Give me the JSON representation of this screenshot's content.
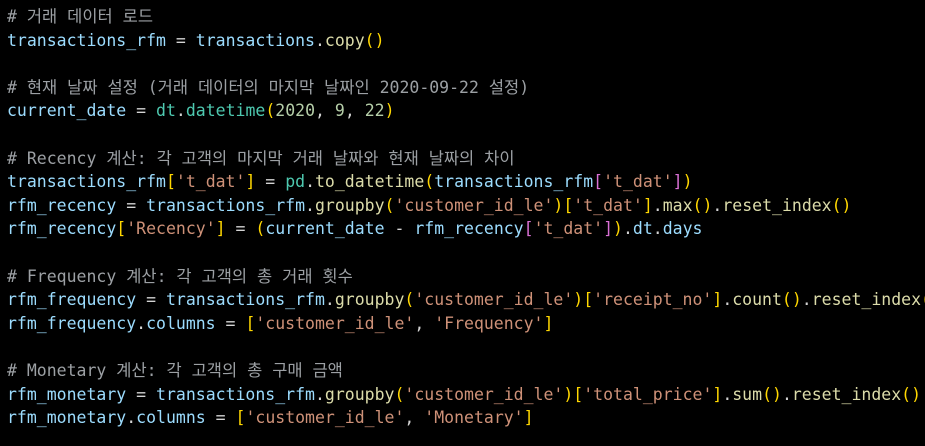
{
  "code": {
    "lines": [
      [
        [
          "c",
          "# 거래 데이터 로드"
        ]
      ],
      [
        [
          "v",
          "transactions_rfm"
        ],
        [
          "o",
          " = "
        ],
        [
          "v",
          "transactions"
        ],
        [
          "p",
          "."
        ],
        [
          "f",
          "copy"
        ],
        [
          "b1",
          "()"
        ]
      ],
      [],
      [
        [
          "c",
          "# 현재 날짜 설정 (거래 데이터의 마지막 날짜인 2020-09-22 설정)"
        ]
      ],
      [
        [
          "v",
          "current_date"
        ],
        [
          "o",
          " = "
        ],
        [
          "ty",
          "dt"
        ],
        [
          "p",
          "."
        ],
        [
          "ty",
          "datetime"
        ],
        [
          "b1",
          "("
        ],
        [
          "n",
          "2020"
        ],
        [
          "p",
          ", "
        ],
        [
          "n",
          "9"
        ],
        [
          "p",
          ", "
        ],
        [
          "n",
          "22"
        ],
        [
          "b1",
          ")"
        ]
      ],
      [],
      [
        [
          "c",
          "# Recency 계산: 각 고객의 마지막 거래 날짜와 현재 날짜의 차이"
        ]
      ],
      [
        [
          "v",
          "transactions_rfm"
        ],
        [
          "b1",
          "["
        ],
        [
          "s",
          "'t_dat'"
        ],
        [
          "b1",
          "]"
        ],
        [
          "o",
          " = "
        ],
        [
          "ty",
          "pd"
        ],
        [
          "p",
          "."
        ],
        [
          "f",
          "to_datetime"
        ],
        [
          "b1",
          "("
        ],
        [
          "v",
          "transactions_rfm"
        ],
        [
          "b2",
          "["
        ],
        [
          "s",
          "'t_dat'"
        ],
        [
          "b2",
          "]"
        ],
        [
          "b1",
          ")"
        ]
      ],
      [
        [
          "v",
          "rfm_recency"
        ],
        [
          "o",
          " = "
        ],
        [
          "v",
          "transactions_rfm"
        ],
        [
          "p",
          "."
        ],
        [
          "f",
          "groupby"
        ],
        [
          "b1",
          "("
        ],
        [
          "s",
          "'customer_id_le'"
        ],
        [
          "b1",
          ")"
        ],
        [
          "b1",
          "["
        ],
        [
          "s",
          "'t_dat'"
        ],
        [
          "b1",
          "]"
        ],
        [
          "p",
          "."
        ],
        [
          "f",
          "max"
        ],
        [
          "b1",
          "()"
        ],
        [
          "p",
          "."
        ],
        [
          "f",
          "reset_index"
        ],
        [
          "b1",
          "()"
        ]
      ],
      [
        [
          "v",
          "rfm_recency"
        ],
        [
          "b1",
          "["
        ],
        [
          "s",
          "'Recency'"
        ],
        [
          "b1",
          "]"
        ],
        [
          "o",
          " = "
        ],
        [
          "b1",
          "("
        ],
        [
          "v",
          "current_date"
        ],
        [
          "o",
          " - "
        ],
        [
          "v",
          "rfm_recency"
        ],
        [
          "b2",
          "["
        ],
        [
          "s",
          "'t_dat'"
        ],
        [
          "b2",
          "]"
        ],
        [
          "b1",
          ")"
        ],
        [
          "p",
          "."
        ],
        [
          "v",
          "dt"
        ],
        [
          "p",
          "."
        ],
        [
          "v",
          "days"
        ]
      ],
      [],
      [
        [
          "c",
          "# Frequency 계산: 각 고객의 총 거래 횟수"
        ]
      ],
      [
        [
          "v",
          "rfm_frequency"
        ],
        [
          "o",
          " = "
        ],
        [
          "v",
          "transactions_rfm"
        ],
        [
          "p",
          "."
        ],
        [
          "f",
          "groupby"
        ],
        [
          "b1",
          "("
        ],
        [
          "s",
          "'customer_id_le'"
        ],
        [
          "b1",
          ")"
        ],
        [
          "b1",
          "["
        ],
        [
          "s",
          "'receipt_no'"
        ],
        [
          "b1",
          "]"
        ],
        [
          "p",
          "."
        ],
        [
          "f",
          "count"
        ],
        [
          "b1",
          "()"
        ],
        [
          "p",
          "."
        ],
        [
          "f",
          "reset_index"
        ],
        [
          "b1",
          "()"
        ]
      ],
      [
        [
          "v",
          "rfm_frequency"
        ],
        [
          "p",
          "."
        ],
        [
          "v",
          "columns"
        ],
        [
          "o",
          " = "
        ],
        [
          "b1",
          "["
        ],
        [
          "s",
          "'customer_id_le'"
        ],
        [
          "p",
          ", "
        ],
        [
          "s",
          "'Frequency'"
        ],
        [
          "b1",
          "]"
        ]
      ],
      [],
      [
        [
          "c",
          "# Monetary 계산: 각 고객의 총 구매 금액"
        ]
      ],
      [
        [
          "v",
          "rfm_monetary"
        ],
        [
          "o",
          " = "
        ],
        [
          "v",
          "transactions_rfm"
        ],
        [
          "p",
          "."
        ],
        [
          "f",
          "groupby"
        ],
        [
          "b1",
          "("
        ],
        [
          "s",
          "'customer_id_le'"
        ],
        [
          "b1",
          ")"
        ],
        [
          "b1",
          "["
        ],
        [
          "s",
          "'total_price'"
        ],
        [
          "b1",
          "]"
        ],
        [
          "p",
          "."
        ],
        [
          "f",
          "sum"
        ],
        [
          "b1",
          "()"
        ],
        [
          "p",
          "."
        ],
        [
          "f",
          "reset_index"
        ],
        [
          "b1",
          "()"
        ]
      ],
      [
        [
          "v",
          "rfm_monetary"
        ],
        [
          "p",
          "."
        ],
        [
          "v",
          "columns"
        ],
        [
          "o",
          " = "
        ],
        [
          "b1",
          "["
        ],
        [
          "s",
          "'customer_id_le'"
        ],
        [
          "p",
          ", "
        ],
        [
          "s",
          "'Monetary'"
        ],
        [
          "b1",
          "]"
        ]
      ]
    ]
  },
  "theme": {
    "background": "#000000",
    "comment": "#9ca0a4",
    "variable": "#9cdcfe",
    "function": "#dcdcaa",
    "string": "#ce9178",
    "number": "#b5cea8",
    "bracket_outer": "#ffd700",
    "bracket_inner": "#da70d6"
  }
}
